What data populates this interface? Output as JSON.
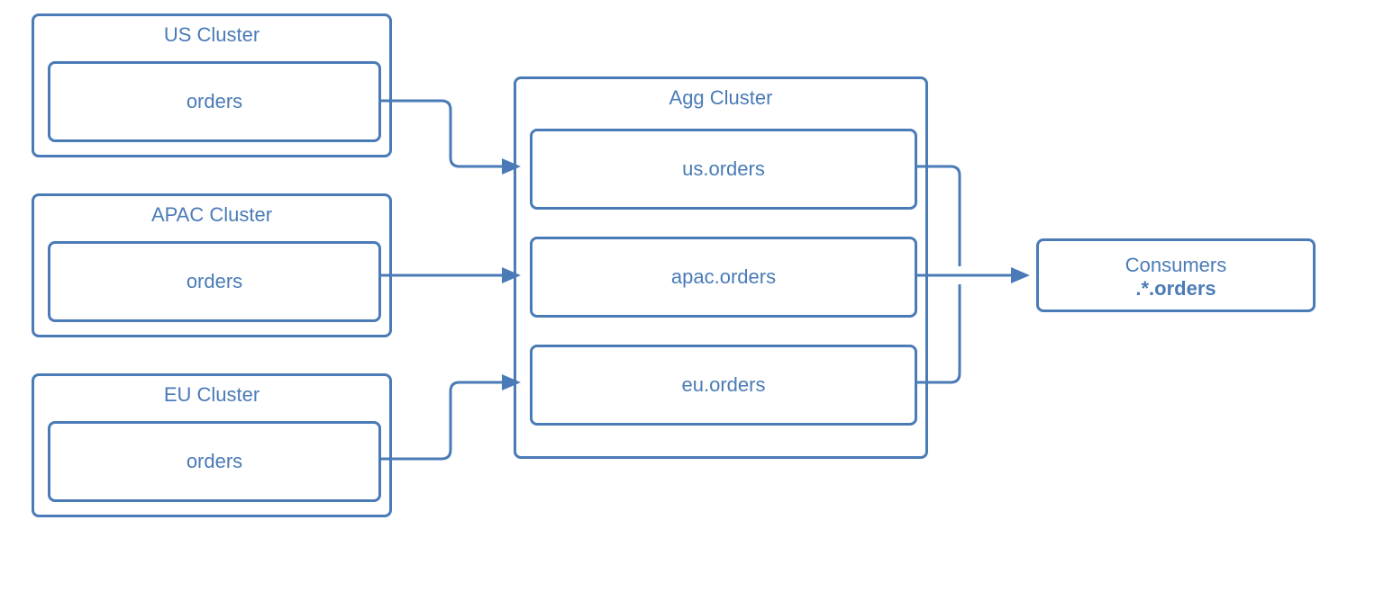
{
  "clusters": {
    "us": {
      "title": "US Cluster",
      "topic": "orders"
    },
    "apac": {
      "title": "APAC Cluster",
      "topic": "orders"
    },
    "eu": {
      "title": "EU Cluster",
      "topic": "orders"
    },
    "agg": {
      "title": "Agg Cluster",
      "topics": {
        "us": "us.orders",
        "apac": "apac.orders",
        "eu": "eu.orders"
      }
    }
  },
  "consumers": {
    "label": "Consumers",
    "pattern": ".*.orders"
  },
  "colors": {
    "stroke": "#4a7bb7",
    "text": "#4a7bb7"
  }
}
